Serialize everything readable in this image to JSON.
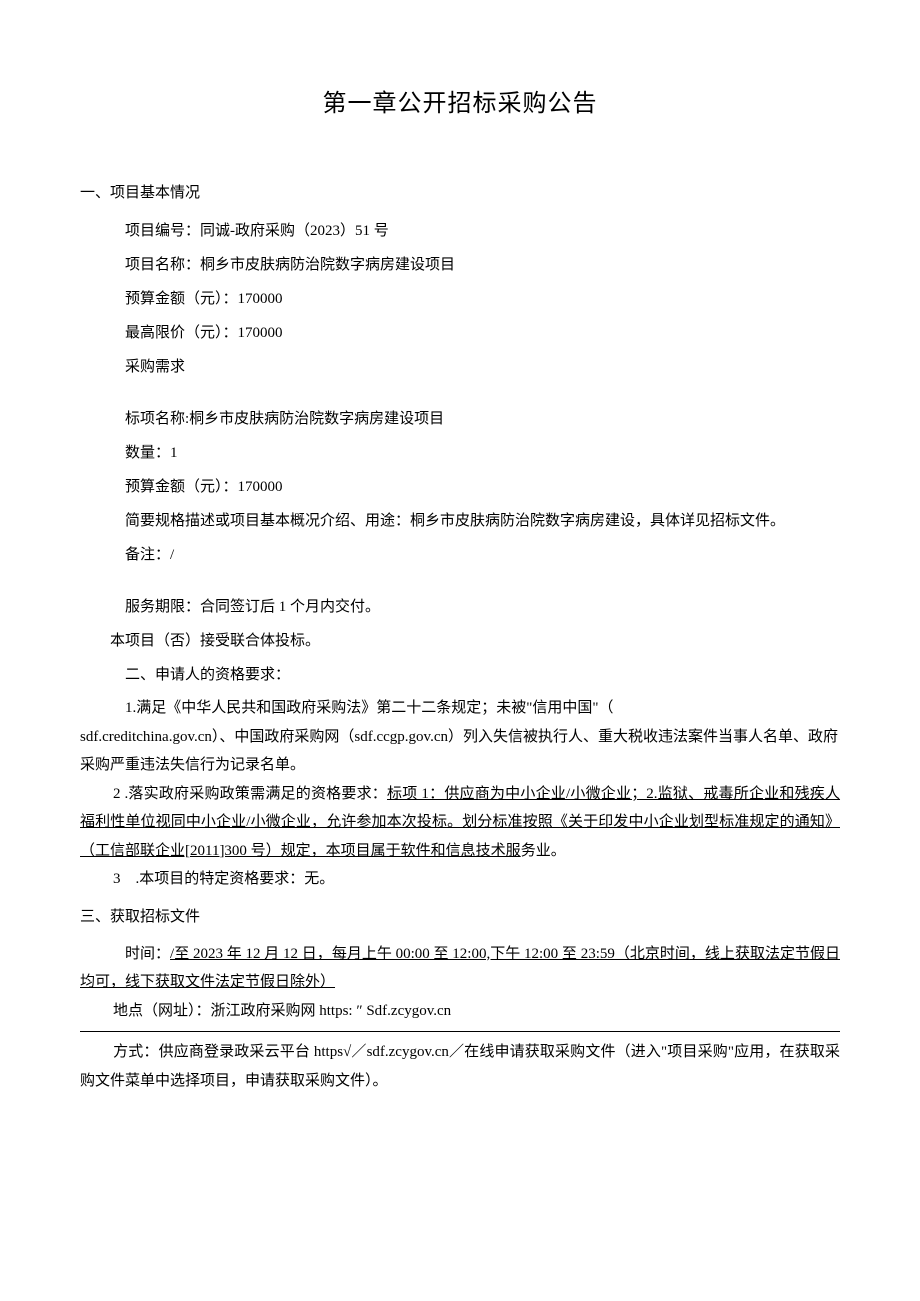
{
  "title": "第一章公开招标采购公告",
  "s1": {
    "heading": "一、项目基本情况",
    "proj_no": "项目编号：同诚-政府采购（2023）51 号",
    "proj_name": "项目名称：桐乡市皮肤病防治院数字病房建设项目",
    "budget": "预算金额（元）：170000",
    "ceiling": "最高限价（元）：170000",
    "req": "采购需求",
    "lot_name": "标项名称:桐乡市皮肤病防治院数字病房建设项目",
    "qty": "数量：1",
    "lot_budget": "预算金额（元）：170000",
    "desc": "简要规格描述或项目基本概况介绍、用途：桐乡市皮肤病防治院数字病房建设，具体详见招标文件。",
    "remark": "备注：/",
    "period": "服务期限：合同签订后 1 个月内交付。",
    "consortium": "本项目（否）接受联合体投标。"
  },
  "s2": {
    "heading": "二、申请人的资格要求：",
    "p1a": "1.满足《中华人民共和国政府采购法》第二十二条规定；未被\"信用中国\"（",
    "p1b": "sdf.creditchina.gov.cn）、中国政府采购网（sdf.ccgp.gov.cn）列入失信被执行人、重大税收违法案件当事人名单、政府采购严重违法失信行为记录名单。",
    "p2_lead": "2 .落实政府采购政策需满足的资格要求：",
    "p2_u1": "标项 1：供应商为中小企业/小微企业；2.监狱、戒毒所企业和残疾人福利性单位视同中小企业/小微企业，允许参加本次投标。划分标准按照《关于印发中小企业划型标准规定的通知》（工信部联企业[2011]300 号）规定，本项目属于软件和信息技术服",
    "p2_tail": "务业。",
    "p3": "3 .本项目的特定资格要求：无。"
  },
  "s3": {
    "heading": "三、获取招标文件",
    "time_lead": "时间：",
    "time_u": "/至 2023 年 12 月 12 日，每月上午 00:00 至 12:00,下午 12:00 至 23:59（北京时间，线上获取法定节假日均可，线下获取文件法定节假日除外）",
    "addr": "地点（网址）：浙江政府采购网 https: ″ Sdf.zcygov.cn",
    "method": "方式：供应商登录政采云平台 https√／sdf.zcygov.cn／在线申请获取采购文件（进入\"项目采购\"应用，在获取采购文件菜单中选择项目，申请获取采购文件）。"
  }
}
